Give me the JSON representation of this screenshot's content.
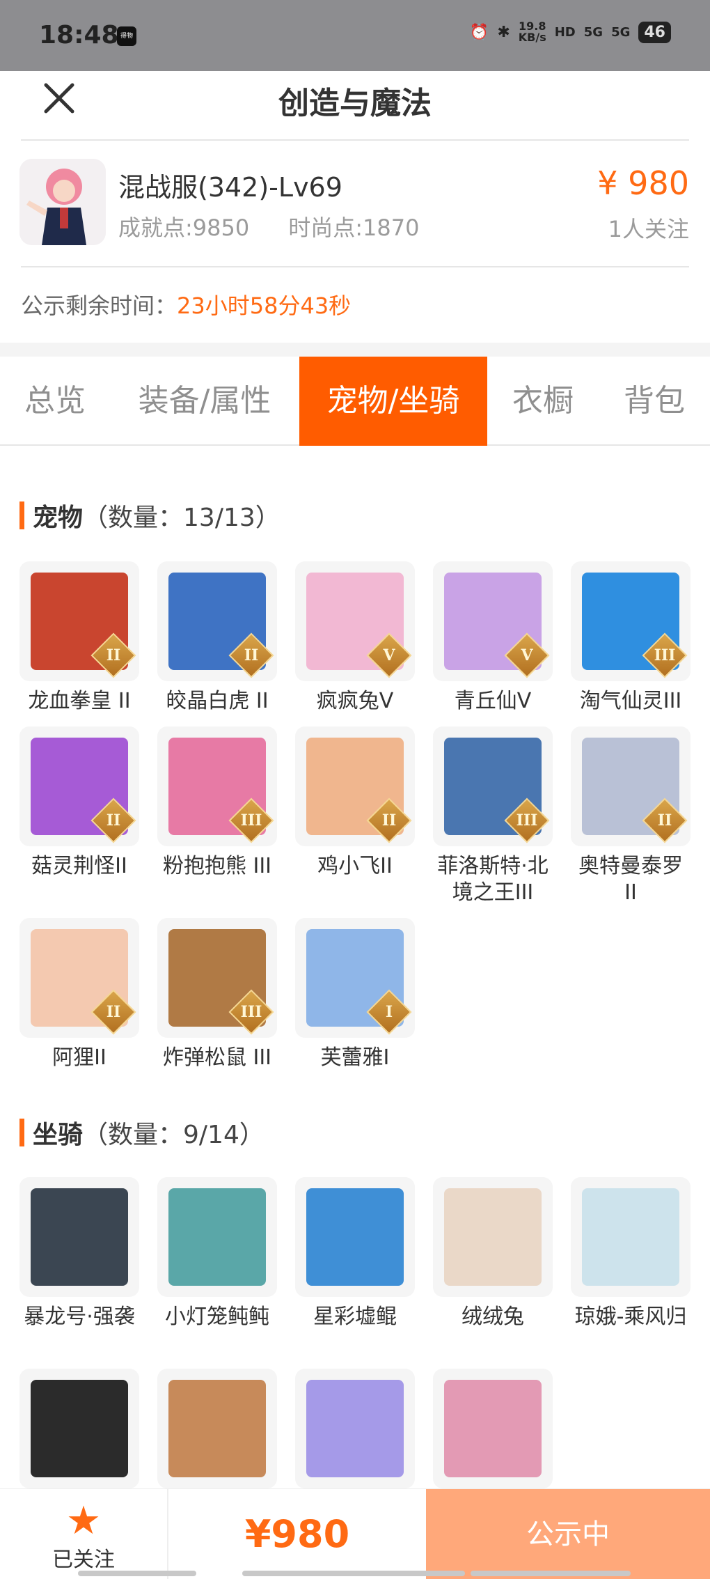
{
  "status_bar": {
    "time": "18:48",
    "app_icon_label": "得物",
    "net_speed": "19.8",
    "net_unit": "KB/s",
    "hd": "HD",
    "sig1": "5G",
    "sig2": "5G",
    "battery": "46"
  },
  "header": {
    "title": "创造与魔法"
  },
  "item": {
    "name": "混战服(342)-Lv69",
    "achievement": "成就点:9850",
    "fashion": "时尚点:1870",
    "price": "¥ 980",
    "followers": "1人关注"
  },
  "countdown": {
    "label": "公示剩余时间：",
    "value": "23小时58分43秒"
  },
  "tabs": [
    {
      "label": "总览",
      "active": false
    },
    {
      "label": "装备/属性",
      "active": false
    },
    {
      "label": "宠物/坐骑",
      "active": true
    },
    {
      "label": "衣橱",
      "active": false
    },
    {
      "label": "背包",
      "active": false
    }
  ],
  "pets": {
    "title": "宠物",
    "count": "（数量：13/13）",
    "items": [
      {
        "name": "龙血拳皇 II",
        "badge": "II",
        "color": "#c9452f"
      },
      {
        "name": "皎晶白虎 II",
        "badge": "II",
        "color": "#3f73c4"
      },
      {
        "name": "疯疯兔V",
        "badge": "V",
        "color": "#f2b8d3"
      },
      {
        "name": "青丘仙V",
        "badge": "V",
        "color": "#c9a3e6"
      },
      {
        "name": "淘气仙灵III",
        "badge": "III",
        "color": "#2f8fe0"
      },
      {
        "name": "菇灵荆怪II",
        "badge": "II",
        "color": "#a65bd6"
      },
      {
        "name": "粉抱抱熊 III",
        "badge": "III",
        "color": "#e77aa5"
      },
      {
        "name": "鸡小飞II",
        "badge": "II",
        "color": "#f0b68e"
      },
      {
        "name": "菲洛斯特·北境之王III",
        "badge": "III",
        "color": "#4a76b0"
      },
      {
        "name": "奥特曼泰罗 II",
        "badge": "II",
        "color": "#b9c1d6"
      },
      {
        "name": "阿狸II",
        "badge": "II",
        "color": "#f4c9b0"
      },
      {
        "name": "炸弹松鼠 III",
        "badge": "III",
        "color": "#b07a45"
      },
      {
        "name": "芙蕾雅I",
        "badge": "I",
        "color": "#8fb6e8"
      }
    ]
  },
  "mounts": {
    "title": "坐骑",
    "count": "（数量：9/14）",
    "items": [
      {
        "name": "暴龙号·强袭",
        "color": "#3b4652"
      },
      {
        "name": "小灯笼鲀鲀",
        "color": "#5aa7a8"
      },
      {
        "name": "星彩墟鲲",
        "color": "#3f8fd6"
      },
      {
        "name": "绒绒兔",
        "color": "#ead8c8"
      },
      {
        "name": "琼娥-乘风归",
        "color": "#cde3ec"
      },
      {
        "name": "",
        "color": "#2b2b2b"
      },
      {
        "name": "",
        "color": "#c78a5a"
      },
      {
        "name": "",
        "color": "#a59ae8"
      },
      {
        "name": "",
        "color": "#e39ab4"
      }
    ]
  },
  "bottom": {
    "follow_icon": "★",
    "follow_label": "已关注",
    "price": "¥980",
    "status": "公示中"
  }
}
